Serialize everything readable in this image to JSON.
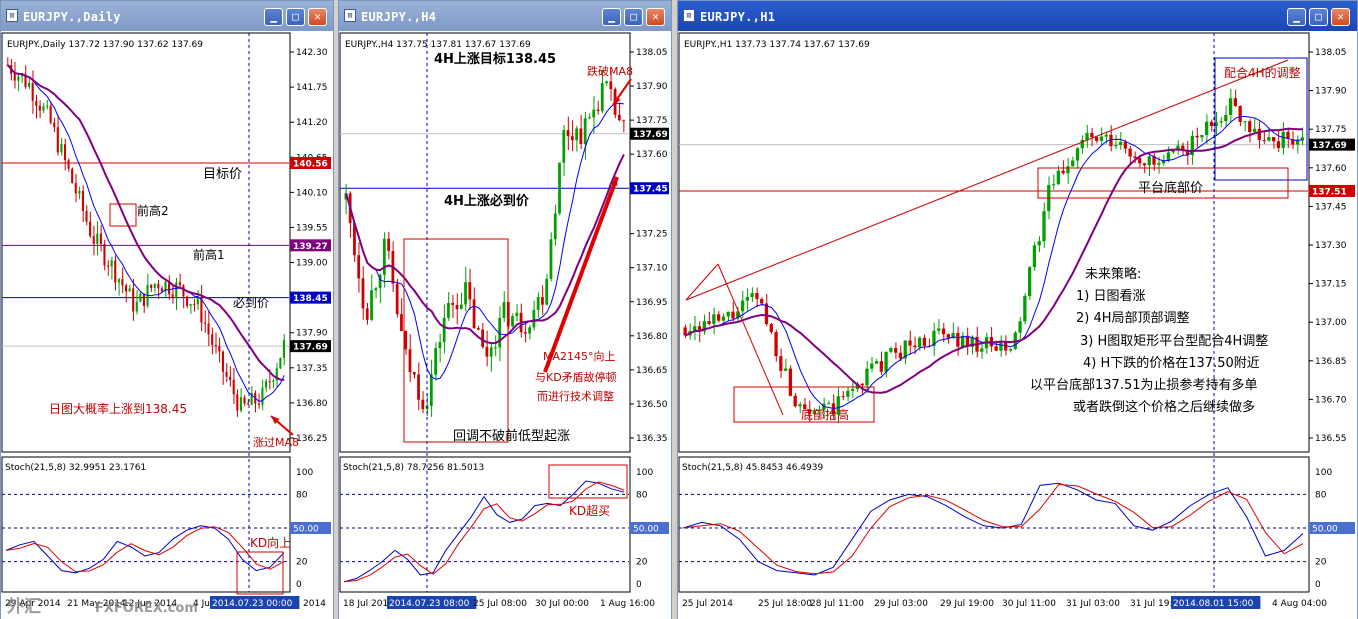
{
  "windows": [
    {
      "title": "EURJPY.,Daily",
      "header": "EURJPY.,Daily  137.72 137.90 137.62 137.69",
      "price_ticks": [
        "142.30",
        "141.75",
        "141.20",
        "140.65",
        "140.10",
        "139.55",
        "139.00",
        "138.45",
        "137.90",
        "137.35",
        "136.80",
        "136.25"
      ],
      "price_flags": [
        {
          "label": "140.56",
          "value": 140.56,
          "color": "#d00000",
          "kind": "line"
        },
        {
          "label": "139.27",
          "value": 139.27,
          "color": "#800080",
          "kind": "line"
        },
        {
          "label": "138.45",
          "value": 138.45,
          "color": "#0000c0",
          "kind": "line"
        },
        {
          "label": "137.69",
          "value": 137.69,
          "color": "#000000",
          "kind": "bid"
        }
      ],
      "stoch_header": "Stoch(21,5,8) 32.9951 23.1761",
      "stoch_ticks": [
        "100",
        "80",
        "50.00",
        "20",
        "0"
      ],
      "time_ticks": [
        "29 Apr 2014",
        "21 May 2014",
        "12 Jun 2014",
        "4 Jul",
        "2014.07.23 00:00",
        "2014"
      ],
      "annotations": [
        {
          "text": "目标价",
          "color": "#000000"
        },
        {
          "text": "前高2",
          "color": "#000000"
        },
        {
          "text": "前高1",
          "color": "#000000"
        },
        {
          "text": "必到价",
          "color": "#000000"
        },
        {
          "text": "日图大概率上涨到138.45",
          "color": "#c00000"
        },
        {
          "text": "涨过MA8",
          "color": "#c00000"
        },
        {
          "text": "KD向上",
          "color": "#c00000"
        }
      ],
      "watermark": "外汇",
      "watermark_url": "FXFOREX.com"
    },
    {
      "title": "EURJPY.,H4",
      "header": "EURJPY.,H4  137.75 137.81 137.67 137.69",
      "price_ticks": [
        "138.05",
        "137.90",
        "137.75",
        "137.60",
        "137.45",
        "137.25",
        "137.10",
        "136.95",
        "136.80",
        "136.65",
        "136.50",
        "136.35"
      ],
      "price_flags": [
        {
          "label": "137.69",
          "value": 137.69,
          "color": "#000000",
          "kind": "bid"
        },
        {
          "label": "137.45",
          "value": 137.45,
          "color": "#0000c0",
          "kind": "line"
        }
      ],
      "stoch_header": "Stoch(21,5,8) 78.7256 81.5013",
      "stoch_ticks": [
        "100",
        "80",
        "50.00",
        "20",
        "0"
      ],
      "time_ticks": [
        "18 Jul 2014",
        "2014.07.23 08:00",
        "25 Jul 08:00",
        "30 Jul 00:00",
        "1 Aug 16:00"
      ],
      "annotations": [
        {
          "text": "4H上涨目标138.45",
          "color": "#000000"
        },
        {
          "text": "跌破MA8",
          "color": "#c00000"
        },
        {
          "text": "4H上涨必到价",
          "color": "#000000"
        },
        {
          "text": "MA2145°向上",
          "color": "#c00000"
        },
        {
          "text": "与KD矛盾故停顿",
          "color": "#c00000"
        },
        {
          "text": "而进行技术调整",
          "color": "#c00000"
        },
        {
          "text": "回调不破前低型起涨",
          "color": "#000000"
        },
        {
          "text": "KD超买",
          "color": "#c00000"
        }
      ]
    },
    {
      "title": "EURJPY.,H1",
      "header": "EURJPY.,H1  137.73 137.74 137.67 137.69",
      "price_ticks": [
        "138.05",
        "137.90",
        "137.75",
        "137.60",
        "137.45",
        "137.30",
        "137.15",
        "137.00",
        "136.85",
        "136.70",
        "136.55"
      ],
      "price_flags": [
        {
          "label": "137.69",
          "value": 137.69,
          "color": "#000000",
          "kind": "bid"
        },
        {
          "label": "137.51",
          "value": 137.51,
          "color": "#d00000",
          "kind": "line"
        }
      ],
      "stoch_header": "Stoch(21,5,8) 45.8453 46.4939",
      "stoch_ticks": [
        "100",
        "80",
        "50.00",
        "20",
        "0"
      ],
      "time_ticks": [
        "25 Jul 2014",
        "25 Jul 18:00",
        "28 Jul 11:00",
        "29 Jul 03:00",
        "29 Jul 19:00",
        "30 Jul 11:00",
        "31 Jul 03:00",
        "31 Jul 19:00",
        "2014.08.01 15:00",
        "4 Aug 04:00"
      ],
      "annotations": [
        {
          "text": "配合4H的调整",
          "color": "#c00000"
        },
        {
          "text": "平台底部价",
          "color": "#000000"
        },
        {
          "text": "底部抬高",
          "color": "#c00000"
        }
      ],
      "strategy": [
        "未来策略:",
        "1) 日图看涨",
        "2) 4H局部顶部调整",
        "3) H图取矩形平台型配合4H调整",
        "4) H下跌的价格在137.50附近",
        "以平台底部137.51为止损参考持有多单",
        "或者跌倒这个价格之后继续做多"
      ]
    }
  ],
  "colors": {
    "bull": "#00a000",
    "bear": "#d00000",
    "ma8": "#0000ff",
    "ma21": "#800080",
    "kd_k": "#0000cc",
    "kd_d": "#dd0000",
    "grid": "#000080"
  }
}
